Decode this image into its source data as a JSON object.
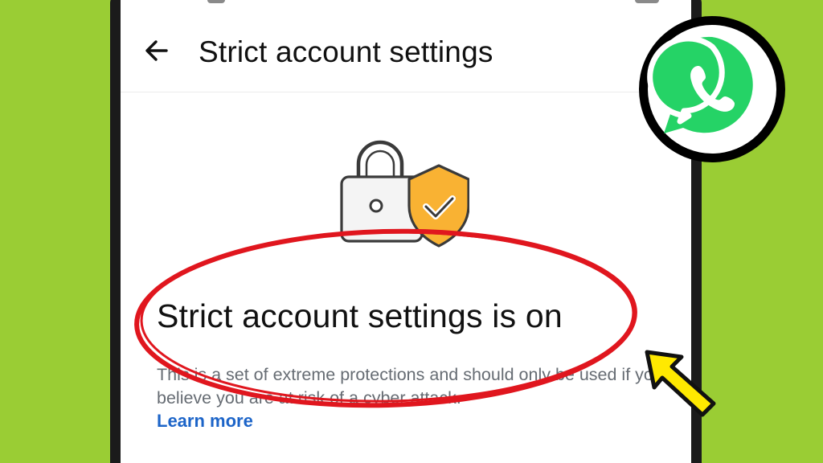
{
  "app_bar": {
    "title": "Strict account settings",
    "back_icon": "arrow-left-icon"
  },
  "illustration": {
    "icons": [
      "padlock-icon",
      "shield-check-icon"
    ],
    "shield_color": "#F9B233",
    "lock_color": "#F4F4F4"
  },
  "content": {
    "headline": "Strict account settings is on",
    "description": "This is a set of extreme protections and should only be used if you believe you are at risk of a cyber attack.",
    "learn_more": "Learn more"
  },
  "overlay": {
    "logo": "whatsapp-logo",
    "logo_color": "#25D366",
    "highlight_color": "#E0161E",
    "arrow_color": "#FFE900",
    "background_color": "#9ACD34"
  }
}
